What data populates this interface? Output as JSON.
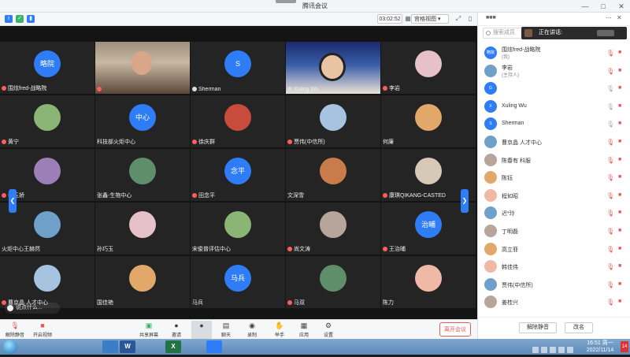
{
  "window": {
    "title": "腾讯会议"
  },
  "toolstrip": {
    "timer": "03:02:52",
    "layout_label": "宫格视图"
  },
  "grid": {
    "cells": [
      {
        "name": "围炫fred-战略院",
        "avatar_text": "略院",
        "avatar": "blue",
        "mic": "muted"
      },
      {
        "name": "",
        "avatar_text": "",
        "avatar": "video-a",
        "mic": "muted"
      },
      {
        "name": "Sherman",
        "avatar_text": "S",
        "avatar": "blue",
        "mic": "on"
      },
      {
        "name": "Xuling Wu",
        "avatar_text": "",
        "avatar": "video-b",
        "mic": "on"
      },
      {
        "name": "李岩",
        "avatar_text": "",
        "avatar": "img",
        "mic": "muted"
      },
      {
        "name": "黄宁",
        "avatar_text": "",
        "avatar": "img",
        "mic": "muted"
      },
      {
        "name": "科技部火炬中心",
        "avatar_text": "中心",
        "avatar": "blue",
        "mic": "none"
      },
      {
        "name": "徐庆群",
        "avatar_text": "",
        "avatar": "img",
        "mic": "muted"
      },
      {
        "name": "贾伟(中信所)",
        "avatar_text": "",
        "avatar": "img",
        "mic": "muted"
      },
      {
        "name": "何廉",
        "avatar_text": "",
        "avatar": "img",
        "mic": "none"
      },
      {
        "name": "张玉娇",
        "avatar_text": "",
        "avatar": "img",
        "mic": "muted"
      },
      {
        "name": "张鑫-生物中心",
        "avatar_text": "",
        "avatar": "img",
        "mic": "none"
      },
      {
        "name": "田念平",
        "avatar_text": "念平",
        "avatar": "blue",
        "mic": "muted"
      },
      {
        "name": "文深雪",
        "avatar_text": "",
        "avatar": "img",
        "mic": "none"
      },
      {
        "name": "康琪QIKANG-CASTED",
        "avatar_text": "",
        "avatar": "img",
        "mic": "muted"
      },
      {
        "name": "火炬中心王赫然",
        "avatar_text": "",
        "avatar": "img",
        "mic": "none"
      },
      {
        "name": "孙巧玉",
        "avatar_text": "",
        "avatar": "img",
        "mic": "none"
      },
      {
        "name": "宋俊普评估中心",
        "avatar_text": "",
        "avatar": "img",
        "mic": "none"
      },
      {
        "name": "尚文涛",
        "avatar_text": "",
        "avatar": "img",
        "mic": "muted"
      },
      {
        "name": "王治晡",
        "avatar_text": "治晡",
        "avatar": "blue",
        "mic": "muted"
      },
      {
        "name": "曹京晶 人才中心",
        "avatar_text": "",
        "avatar": "img",
        "mic": "muted"
      },
      {
        "name": "国佳艳",
        "avatar_text": "",
        "avatar": "img",
        "mic": "none"
      },
      {
        "name": "马兵",
        "avatar_text": "马兵",
        "avatar": "blue",
        "mic": "none"
      },
      {
        "name": "马双",
        "avatar_text": "",
        "avatar": "img",
        "mic": "muted"
      },
      {
        "name": "陈力",
        "avatar_text": "",
        "avatar": "img",
        "mic": "none"
      }
    ]
  },
  "bubble": {
    "text": "说点什么..."
  },
  "toolbar": {
    "mute": "解除静音",
    "video": "开启视频",
    "share": "共享屏幕",
    "invite": "邀请",
    "members": "",
    "chat": "聊天",
    "record": "录制",
    "hand": "举手",
    "apps": "应用",
    "settings": "设置",
    "leave": "离开会议"
  },
  "panel": {
    "search_placeholder": "搜索成员",
    "speaking_label": "正在讲话:",
    "participants": [
      {
        "name": "围炫fred-战略院",
        "role": "(我)",
        "avatar_text": "略院",
        "avatar": "blue",
        "mic": "muted"
      },
      {
        "name": "李岩",
        "role": "(主持人)",
        "avatar_text": "",
        "avatar": "img",
        "mic": "muted"
      },
      {
        "name": "",
        "role": "",
        "avatar_text": "G",
        "avatar": "blue",
        "mic": "on"
      },
      {
        "name": "Xuling Wu",
        "role": "",
        "avatar_text": "X",
        "avatar": "blue",
        "mic": "on"
      },
      {
        "name": "Sherman",
        "role": "",
        "avatar_text": "S",
        "avatar": "blue",
        "mic": "on"
      },
      {
        "name": "曹京晶 人才中心",
        "role": "",
        "avatar_text": "",
        "avatar": "img",
        "mic": "muted"
      },
      {
        "name": "陈春有 科服",
        "role": "",
        "avatar_text": "",
        "avatar": "img",
        "mic": "muted"
      },
      {
        "name": "陈钰",
        "role": "",
        "avatar_text": "",
        "avatar": "img",
        "mic": "muted"
      },
      {
        "name": "程如昭",
        "role": "",
        "avatar_text": "",
        "avatar": "img",
        "mic": "muted"
      },
      {
        "name": "迟*玲",
        "role": "",
        "avatar_text": "",
        "avatar": "img",
        "mic": "muted"
      },
      {
        "name": "丁明磊",
        "role": "",
        "avatar_text": "",
        "avatar": "img",
        "mic": "muted"
      },
      {
        "name": "高立菲",
        "role": "",
        "avatar_text": "",
        "avatar": "img",
        "mic": "muted"
      },
      {
        "name": "韩佳伟",
        "role": "",
        "avatar_text": "",
        "avatar": "img",
        "mic": "muted"
      },
      {
        "name": "贾伟(中信所)",
        "role": "",
        "avatar_text": "",
        "avatar": "img",
        "mic": "muted"
      },
      {
        "name": "姜桂兴",
        "role": "",
        "avatar_text": "",
        "avatar": "img",
        "mic": "muted"
      }
    ],
    "unmute_all": "解除静音",
    "rename": "改名"
  },
  "taskbar": {
    "apps": [
      "",
      "W",
      "X",
      ""
    ],
    "clock_time": "16:51 周一",
    "clock_date": "2022/11/14",
    "notifications": "14"
  }
}
